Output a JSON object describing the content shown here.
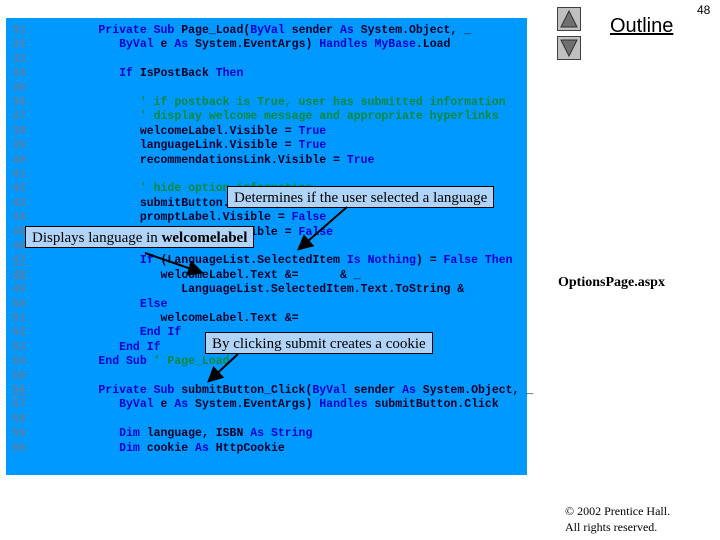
{
  "header": {
    "page_number": "48",
    "outline_label": "Outline",
    "nav_up_icon": "triangle-up-icon",
    "nav_down_icon": "triangle-down-icon"
  },
  "sidebar": {
    "filename": "OptionsPage.aspx",
    "copyright_line1": "© 2002 Prentice Hall.",
    "copyright_line2": "All rights reserved."
  },
  "colors": {
    "code_background": "#0099ff",
    "keyword": "#0000cc",
    "text": "#00002a",
    "comment": "#0a8a3a",
    "line_number": "#5a7fa8",
    "callout_background": "#b0d4f8"
  },
  "code_lines": [
    {
      "n": "31",
      "u": false,
      "segs": [
        [
          "k",
          "      Private Sub "
        ],
        [
          "t",
          "Page_Load("
        ],
        [
          "k",
          "ByVal"
        ],
        [
          "t",
          " sender "
        ],
        [
          "k",
          "As"
        ],
        [
          "t",
          " System.Object, _"
        ]
      ]
    },
    {
      "n": "32",
      "u": false,
      "segs": [
        [
          "k",
          "         ByVal"
        ],
        [
          "t",
          " e "
        ],
        [
          "k",
          "As"
        ],
        [
          "t",
          " System.EventArgs) "
        ],
        [
          "k",
          "Handles MyBase"
        ],
        [
          "t",
          ".Load"
        ]
      ]
    },
    {
      "n": "33",
      "u": false,
      "segs": []
    },
    {
      "n": "34",
      "u": false,
      "segs": [
        [
          "k",
          "         If "
        ],
        [
          "t",
          "IsPostBack "
        ],
        [
          "k",
          "Then"
        ]
      ]
    },
    {
      "n": "35",
      "u": false,
      "segs": []
    },
    {
      "n": "36",
      "u": false,
      "segs": [
        [
          "c",
          "            ' if postback is True, user has submitted information"
        ]
      ]
    },
    {
      "n": "37",
      "u": false,
      "segs": [
        [
          "c",
          "            ' display welcome message and appropriate hyperlinks"
        ]
      ]
    },
    {
      "n": "38",
      "u": false,
      "segs": [
        [
          "t",
          "            welcomeLabel.Visible = "
        ],
        [
          "k",
          "True"
        ]
      ]
    },
    {
      "n": "39",
      "u": false,
      "segs": [
        [
          "t",
          "            languageLink.Visible = "
        ],
        [
          "k",
          "True"
        ]
      ]
    },
    {
      "n": "40",
      "u": false,
      "segs": [
        [
          "t",
          "            recommendationsLink.Visible = "
        ],
        [
          "k",
          "True"
        ]
      ]
    },
    {
      "n": "41",
      "u": false,
      "segs": []
    },
    {
      "n": "42",
      "u": false,
      "segs": [
        [
          "c",
          "            ' hide option information"
        ]
      ]
    },
    {
      "n": "43",
      "u": false,
      "segs": [
        [
          "t",
          "            submitButton.Visible = "
        ],
        [
          "k",
          "False"
        ]
      ]
    },
    {
      "n": "44",
      "u": false,
      "segs": [
        [
          "t",
          "            promptLabel.Visible = "
        ],
        [
          "k",
          "False"
        ]
      ]
    },
    {
      "n": "45",
      "u": false,
      "segs": [
        [
          "t",
          "            languageList.Visible = "
        ],
        [
          "k",
          "False"
        ]
      ]
    },
    {
      "n": "46",
      "u": false,
      "segs": []
    },
    {
      "n": "47",
      "u": true,
      "segs": [
        [
          "k",
          "            If "
        ],
        [
          "t",
          "(LanguageList.SelectedItem "
        ],
        [
          "k",
          "Is Nothing"
        ],
        [
          "t",
          ") = "
        ],
        [
          "k",
          "False Then"
        ]
      ]
    },
    {
      "n": "48",
      "u": true,
      "segs": [
        [
          "t",
          "               welcomeLabel.Text &=      & _"
        ]
      ]
    },
    {
      "n": "49",
      "u": false,
      "segs": [
        [
          "t",
          "                  LanguageList.SelectedItem.Text.ToString &"
        ]
      ]
    },
    {
      "n": "50",
      "u": false,
      "segs": [
        [
          "k",
          "            Else"
        ]
      ]
    },
    {
      "n": "51",
      "u": false,
      "segs": [
        [
          "t",
          "               welcomeLabel.Text &="
        ]
      ]
    },
    {
      "n": "52",
      "u": false,
      "segs": [
        [
          "k",
          "            End If"
        ]
      ]
    },
    {
      "n": "53",
      "u": false,
      "segs": [
        [
          "k",
          "         End If"
        ]
      ]
    },
    {
      "n": "54",
      "u": false,
      "segs": [
        [
          "k",
          "      End Sub "
        ],
        [
          "c",
          "' Page_Load"
        ]
      ]
    },
    {
      "n": "55",
      "u": false,
      "segs": []
    },
    {
      "n": "56",
      "u": true,
      "segs": [
        [
          "k",
          "      Private Sub "
        ],
        [
          "t",
          "submitButton_Click("
        ],
        [
          "k",
          "ByVal"
        ],
        [
          "t",
          " sender "
        ],
        [
          "k",
          "As"
        ],
        [
          "t",
          " System.Object, _"
        ]
      ]
    },
    {
      "n": "57",
      "u": false,
      "segs": [
        [
          "k",
          "         ByVal"
        ],
        [
          "t",
          " e "
        ],
        [
          "k",
          "As"
        ],
        [
          "t",
          " System.EventArgs) "
        ],
        [
          "k",
          "Handles"
        ],
        [
          "t",
          " submitButton.Click"
        ]
      ]
    },
    {
      "n": "58",
      "u": false,
      "segs": []
    },
    {
      "n": "59",
      "u": false,
      "segs": [
        [
          "k",
          "         Dim"
        ],
        [
          "t",
          " language, ISBN "
        ],
        [
          "k",
          "As String"
        ]
      ]
    },
    {
      "n": "60",
      "u": false,
      "segs": [
        [
          "k",
          "         Dim"
        ],
        [
          "t",
          " cookie "
        ],
        [
          "k",
          "As"
        ],
        [
          "t",
          " HttpCookie"
        ]
      ]
    }
  ],
  "callouts": {
    "determines": "Determines if the user selected a language",
    "displays_prefix": "Displays language in ",
    "displays_bold": "welcomelabel",
    "cookie": "By clicking submit creates a cookie"
  }
}
